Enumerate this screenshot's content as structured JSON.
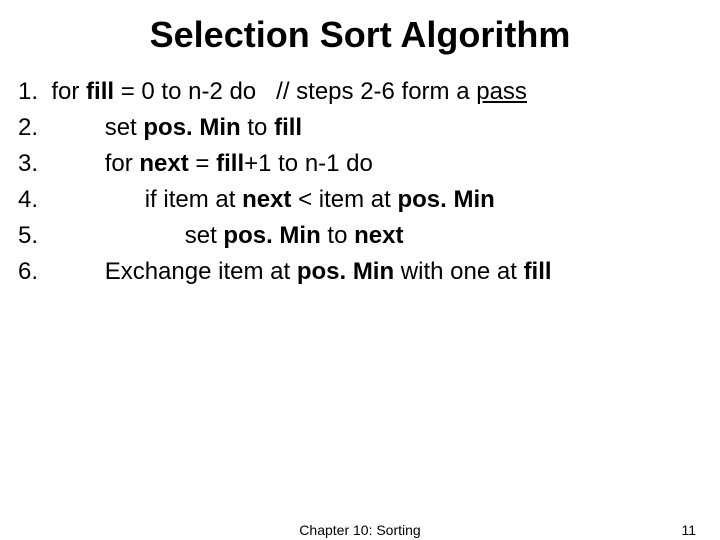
{
  "title": "Selection Sort Algorithm",
  "lines": {
    "l1_num": "1.  ",
    "l1_a": "for ",
    "l1_fill": "fill",
    "l1_b": " = 0 to n-2 do   // steps 2-6 form a ",
    "l1_pass": "pass",
    "l2_num": "2.          ",
    "l2_a": "set ",
    "l2_posmin": "pos. Min",
    "l2_b": " to ",
    "l2_fill": "fill",
    "l3_num": "3.          ",
    "l3_a": "for ",
    "l3_next": "next",
    "l3_b": " = ",
    "l3_fill": "fill",
    "l3_c": "+1 to n-1 do",
    "l4_num": "4.                ",
    "l4_a": "if item at ",
    "l4_next": "next",
    "l4_b": " < item at ",
    "l4_posmin": "pos. Min",
    "l5_num": "5.                      ",
    "l5_a": "set ",
    "l5_posmin": "pos. Min",
    "l5_b": " to ",
    "l5_next": "next",
    "l6_num": "6.          ",
    "l6_a": "Exchange item at ",
    "l6_posmin": "pos. Min",
    "l6_b": " with one at ",
    "l6_fill": "fill"
  },
  "footer": {
    "center": "Chapter 10: Sorting",
    "right": "11"
  }
}
